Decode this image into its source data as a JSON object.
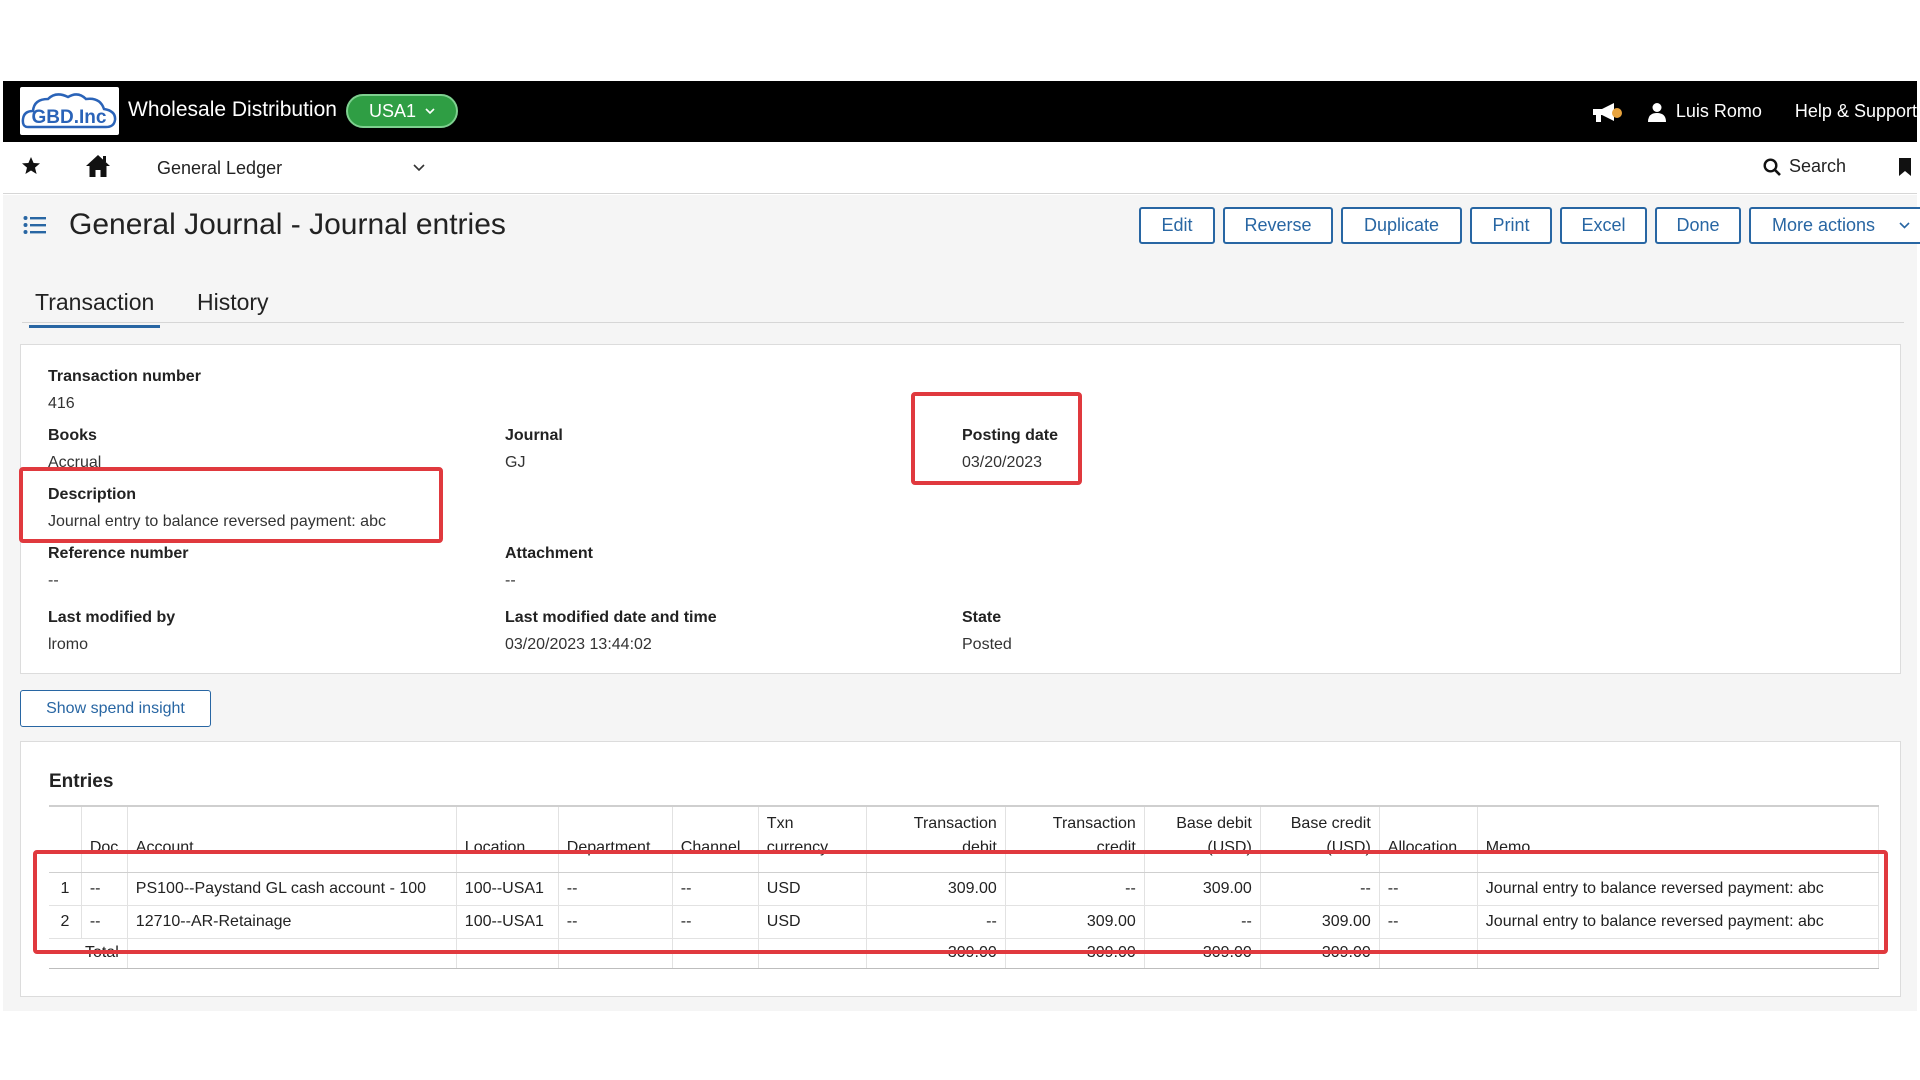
{
  "header": {
    "logo_text": "GBD.Inc",
    "company": "Wholesale Distribution",
    "entity": "USA1",
    "user": "Luis Romo",
    "help": "Help & Support"
  },
  "subnav": {
    "module": "General Ledger",
    "search": "Search"
  },
  "page": {
    "title": "General Journal - Journal entries",
    "actions": [
      "Edit",
      "Reverse",
      "Duplicate",
      "Print",
      "Excel",
      "Done",
      "More actions"
    ]
  },
  "tabs": [
    "Transaction",
    "History"
  ],
  "transaction": {
    "number_label": "Transaction number",
    "number": "416",
    "books_label": "Books",
    "books": "Accrual",
    "journal_label": "Journal",
    "journal": "GJ",
    "posting_date_label": "Posting date",
    "posting_date": "03/20/2023",
    "description_label": "Description",
    "description": "Journal entry to balance reversed payment: abc",
    "reference_label": "Reference number",
    "reference": "--",
    "attachment_label": "Attachment",
    "attachment": "--",
    "modified_by_label": "Last modified by",
    "modified_by": "lromo",
    "modified_at_label": "Last modified date and time",
    "modified_at": "03/20/2023 13:44:02",
    "state_label": "State",
    "state": "Posted"
  },
  "spend_insight": "Show spend insight",
  "entries": {
    "title": "Entries",
    "columns": {
      "doc": "Doc",
      "account": "Account",
      "location": "Location",
      "department": "Department",
      "channel": "Channel",
      "txn_currency_1": "Txn",
      "txn_currency_2": "currency",
      "txn_debit_1": "Transaction",
      "txn_debit_2": "debit",
      "txn_credit_1": "Transaction",
      "txn_credit_2": "credit",
      "base_debit_1": "Base debit",
      "base_debit_2": "(USD)",
      "base_credit_1": "Base credit",
      "base_credit_2": "(USD)",
      "allocation": "Allocation",
      "memo": "Memo"
    },
    "rows": [
      {
        "line": "1",
        "doc": "--",
        "account": "PS100--Paystand GL cash account - 100",
        "location": "100--USA1",
        "department": "--",
        "channel": "--",
        "currency": "USD",
        "txn_debit": "309.00",
        "txn_credit": "--",
        "base_debit": "309.00",
        "base_credit": "--",
        "allocation": "--",
        "memo": "Journal entry to balance reversed payment: abc"
      },
      {
        "line": "2",
        "doc": "--",
        "account": "12710--AR-Retainage",
        "location": "100--USA1",
        "department": "--",
        "channel": "--",
        "currency": "USD",
        "txn_debit": "--",
        "txn_credit": "309.00",
        "base_debit": "--",
        "base_credit": "309.00",
        "allocation": "--",
        "memo": "Journal entry to balance reversed payment: abc"
      }
    ],
    "total": {
      "label": "Total",
      "txn_debit": "309.00",
      "txn_credit": "309.00",
      "base_debit": "309.00",
      "base_credit": "309.00"
    }
  },
  "colors": {
    "accent": "#2866a3",
    "entity_pill": "#2f9e44",
    "highlight": "#e0393e"
  }
}
